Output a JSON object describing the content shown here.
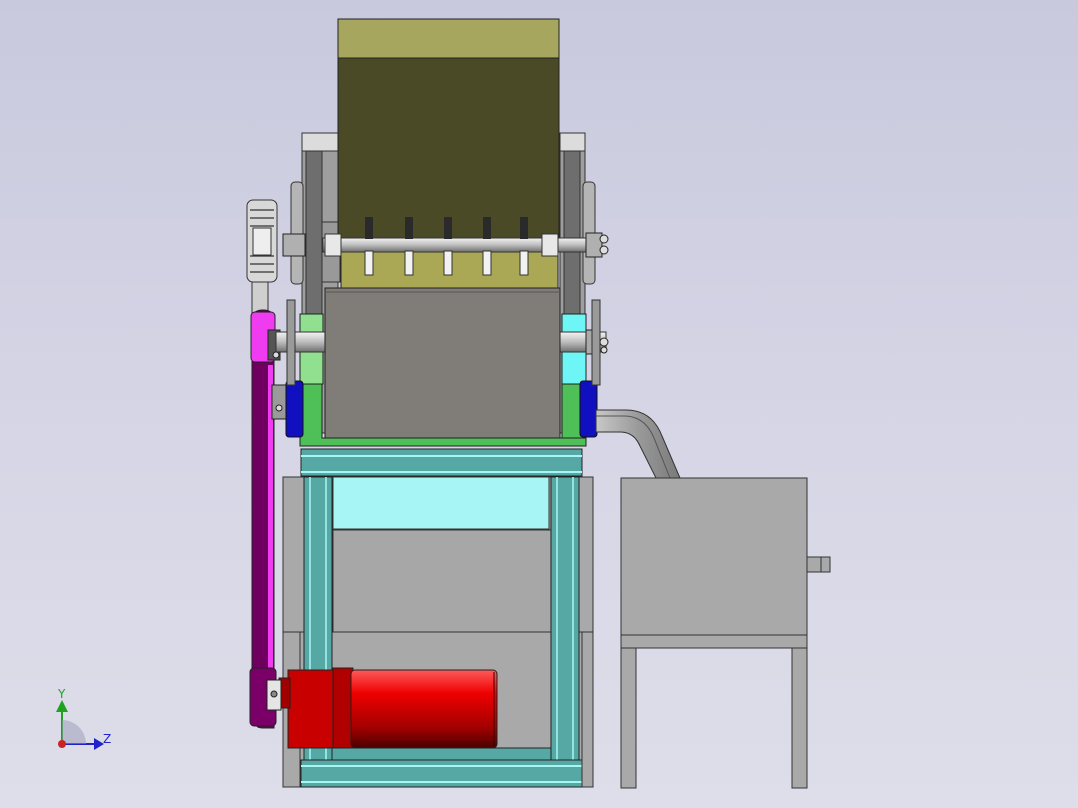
{
  "viewport": {
    "background_top": "#c9c9de",
    "background_bottom": "#dedeea"
  },
  "triad": {
    "y_label": "Y",
    "z_label": "Z",
    "y_color": "#1fa31f",
    "z_color": "#2222cc",
    "origin_color": "#cc2222"
  },
  "colors": {
    "hopper_top": "#a7a65e",
    "hopper_body": "#4b4a26",
    "crusher_chamber": "#aaa855",
    "lower_chamber": "#807c78",
    "frame_teal": "#56a8a4",
    "frame_light": "#a8f5f5",
    "motor_red": "#e80000",
    "belt_purple": "#700060",
    "pulley_magenta": "#f03cf0",
    "bearing_cyan": "#6ef5f5",
    "bearing_green": "#4fbf57",
    "bearing_blue": "#1010c0",
    "bin_grey": "#a9a9a9"
  }
}
